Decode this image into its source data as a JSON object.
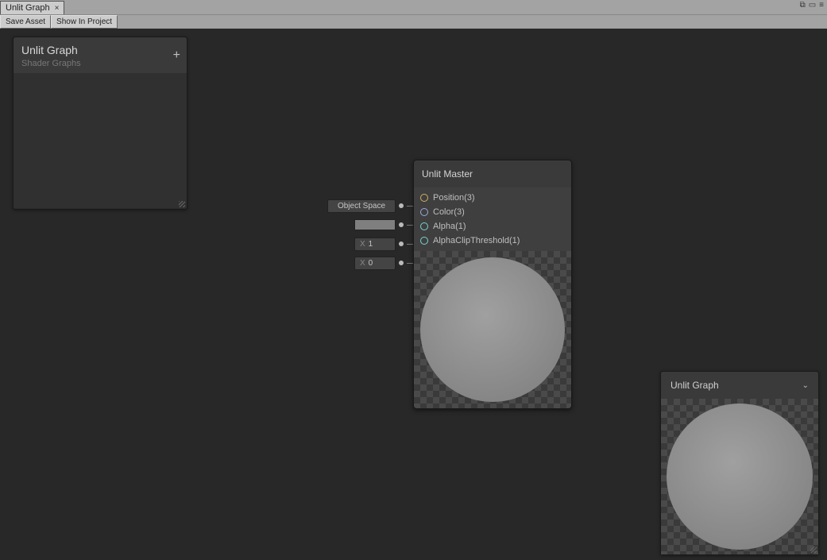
{
  "tab": {
    "title": "Unlit Graph"
  },
  "toolbar": {
    "save_label": "Save Asset",
    "show_label": "Show In Project"
  },
  "blackboard": {
    "title": "Unlit Graph",
    "subtitle": "Shader Graphs"
  },
  "node": {
    "title": "Unlit Master",
    "ports": [
      {
        "label": "Position(3)"
      },
      {
        "label": "Color(3)"
      },
      {
        "label": "Alpha(1)"
      },
      {
        "label": "AlphaClipThreshold(1)"
      }
    ]
  },
  "ext": {
    "space": "Object Space",
    "color": "#7f7f7f",
    "alpha_prefix": "X",
    "alpha_value": "1",
    "clip_prefix": "X",
    "clip_value": "0"
  },
  "preview": {
    "title": "Unlit Graph"
  }
}
